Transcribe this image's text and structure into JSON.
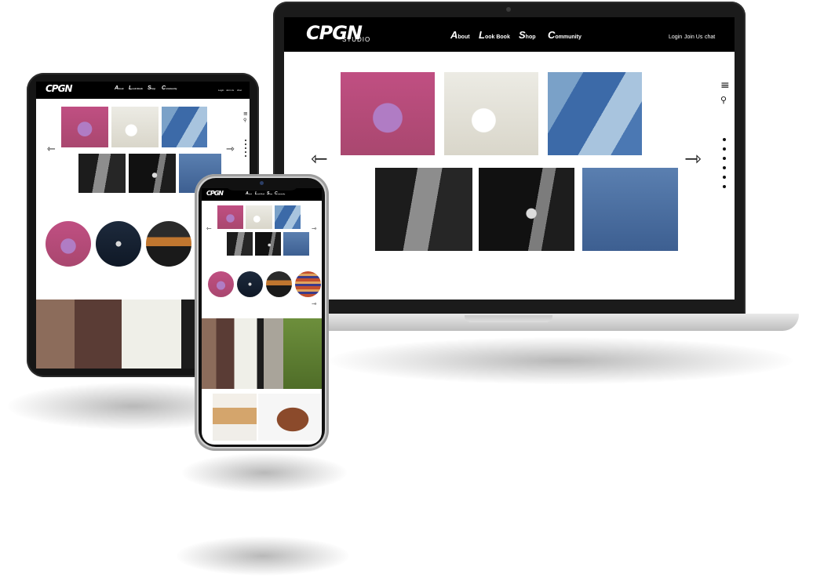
{
  "brand": {
    "logo_text": "CPGN",
    "logo_sub": "STUDIO"
  },
  "nav": [
    {
      "initial": "A",
      "rest": "bout"
    },
    {
      "initial": "L",
      "rest": "ook Book"
    },
    {
      "initial": "S",
      "rest": "hop"
    },
    {
      "initial": "C",
      "rest": "ommunity"
    }
  ],
  "utility": {
    "login": "Login",
    "join": "Join Us",
    "chat": "chat"
  },
  "icons": {
    "menu": "menu-icon",
    "search": "search-icon",
    "arrow_prev": "arrow-left-icon",
    "arrow_next": "arrow-right-icon"
  },
  "colors": {
    "header_bg": "#000000",
    "device_frame": "#1b1b1b",
    "accent_pink": "#c04f82",
    "accent_denim": "#3c6aa8"
  }
}
